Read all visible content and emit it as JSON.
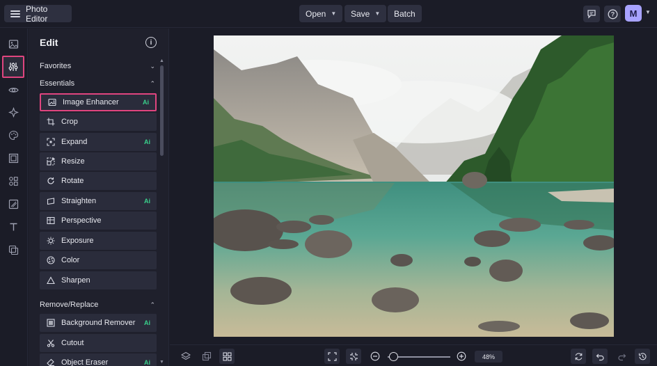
{
  "header": {
    "app_title": "Photo Editor",
    "open_label": "Open",
    "save_label": "Save",
    "batch_label": "Batch",
    "avatar_letter": "M"
  },
  "panel": {
    "title": "Edit",
    "sections": {
      "favorites": "Favorites",
      "essentials": "Essentials",
      "remove_replace": "Remove/Replace"
    },
    "tools": [
      {
        "label": "Image Enhancer",
        "icon": "image-enhancer-icon",
        "ai": "Ai"
      },
      {
        "label": "Crop",
        "icon": "crop-icon"
      },
      {
        "label": "Expand",
        "icon": "expand-icon",
        "ai": "Ai"
      },
      {
        "label": "Resize",
        "icon": "resize-icon"
      },
      {
        "label": "Rotate",
        "icon": "rotate-icon"
      },
      {
        "label": "Straighten",
        "icon": "straighten-icon",
        "ai": "Ai"
      },
      {
        "label": "Perspective",
        "icon": "perspective-icon"
      },
      {
        "label": "Exposure",
        "icon": "exposure-icon"
      },
      {
        "label": "Color",
        "icon": "color-icon"
      },
      {
        "label": "Sharpen",
        "icon": "sharpen-icon"
      }
    ],
    "remove_tools": [
      {
        "label": "Background Remover",
        "icon": "background-remover-icon",
        "ai": "Ai"
      },
      {
        "label": "Cutout",
        "icon": "cutout-icon"
      },
      {
        "label": "Object Eraser",
        "icon": "object-eraser-icon",
        "ai": "Ai"
      }
    ]
  },
  "zoom": {
    "value": "48%"
  },
  "colors": {
    "accent_highlight": "#e0457f",
    "ai_badge": "#39d08b",
    "avatar": "#a8a3ff"
  }
}
